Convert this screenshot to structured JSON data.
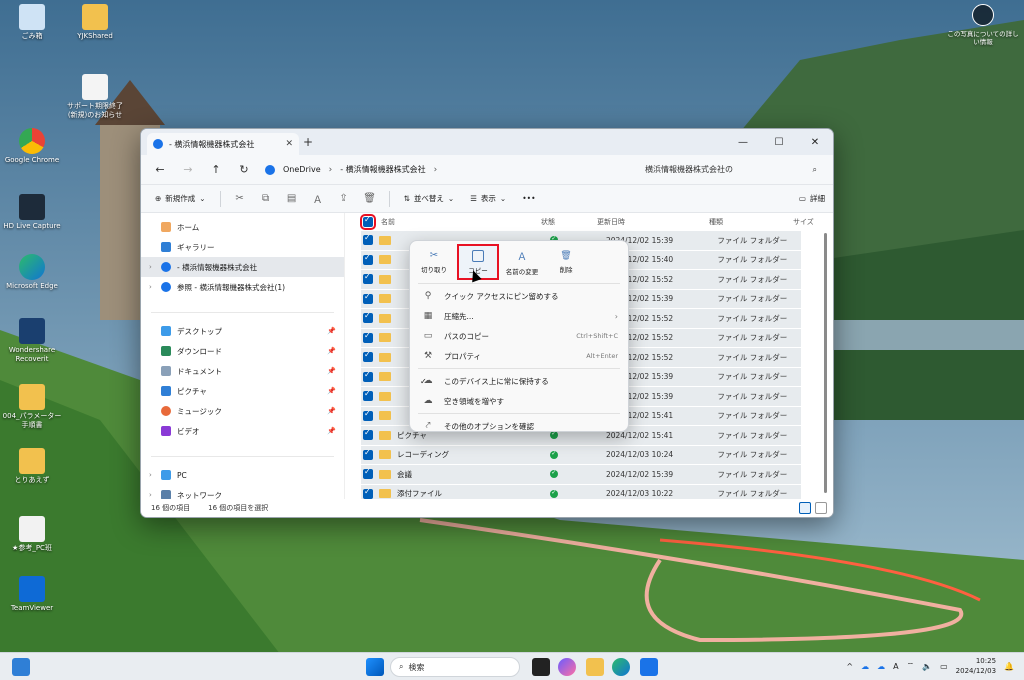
{
  "desktop": {
    "icons": [
      {
        "label": "ごみ箱"
      },
      {
        "label": "YJKShared"
      },
      {
        "label": "サポート期限終了(新規)のお知らせ"
      },
      {
        "label": "Google Chrome"
      },
      {
        "label": "HD Live Capture"
      },
      {
        "label": "Microsoft Edge"
      },
      {
        "label": "Wondershare Recoverit"
      },
      {
        "label": "004_パラメーター手順書"
      },
      {
        "label": "とりあえず"
      },
      {
        "label": "★参考_PC班"
      },
      {
        "label": "TeamViewer"
      }
    ],
    "photo_info": "この写真についての詳しい情報"
  },
  "window": {
    "tab_title": "- 横浜情報機器株式会社",
    "crumbs": [
      "OneDrive",
      "- 横浜情報機器株式会社"
    ],
    "search_placeholder": "横浜情報機器株式会社の",
    "toolbar": {
      "new": "新規作成",
      "sort": "並べ替え",
      "view": "表示",
      "more": "•••",
      "details": "詳細"
    },
    "nav": {
      "home": "ホーム",
      "gallery": "ギャラリー",
      "onedrive_org": "- 横浜情報機器株式会社",
      "onedrive_personal": "参照 - 横浜情報機器株式会社(1)",
      "desktop": "デスクトップ",
      "downloads": "ダウンロード",
      "documents": "ドキュメント",
      "pictures": "ピクチャ",
      "music": "ミュージック",
      "videos": "ビデオ",
      "pc": "PC",
      "network": "ネットワーク"
    },
    "columns": {
      "name": "名前",
      "status": "状態",
      "date": "更新日時",
      "type": "種類",
      "size": "サイズ"
    },
    "rows": [
      {
        "name": "",
        "date": "2024/12/02 15:39",
        "type": "ファイル フォルダー"
      },
      {
        "name": "",
        "date": "2024/12/02 15:40",
        "type": "ファイル フォルダー"
      },
      {
        "name": "",
        "date": "2024/12/02 15:52",
        "type": "ファイル フォルダー"
      },
      {
        "name": "",
        "date": "2024/12/02 15:39",
        "type": "ファイル フォルダー"
      },
      {
        "name": "",
        "date": "2024/12/02 15:52",
        "type": "ファイル フォルダー"
      },
      {
        "name": "",
        "date": "2024/12/02 15:52",
        "type": "ファイル フォルダー"
      },
      {
        "name": "",
        "date": "2024/12/02 15:52",
        "type": "ファイル フォルダー"
      },
      {
        "name": "",
        "date": "2024/12/02 15:39",
        "type": "ファイル フォルダー"
      },
      {
        "name": "",
        "date": "2024/12/02 15:39",
        "type": "ファイル フォルダー"
      },
      {
        "name": "",
        "date": "2024/12/02 15:41",
        "type": "ファイル フォルダー"
      },
      {
        "name": "ピクチャ",
        "date": "2024/12/02 15:41",
        "type": "ファイル フォルダー"
      },
      {
        "name": "レコーディング",
        "date": "2024/12/03 10:24",
        "type": "ファイル フォルダー"
      },
      {
        "name": "会議",
        "date": "2024/12/02 15:39",
        "type": "ファイル フォルダー"
      },
      {
        "name": "添付ファイル",
        "date": "2024/12/03 10:22",
        "type": "ファイル フォルダー"
      }
    ],
    "status_count": "16 個の項目",
    "status_selected": "16 個の項目を選択"
  },
  "context_menu": {
    "actions": [
      {
        "label": "切り取り"
      },
      {
        "label": "コピー"
      },
      {
        "label": "名前の変更"
      },
      {
        "label": "削除"
      }
    ],
    "items": {
      "pin_quick": "クイック アクセスにピン留めする",
      "compress": "圧縮先...",
      "copy_path": "パスのコピー",
      "copy_path_shortcut": "Ctrl+Shift+C",
      "properties": "プロパティ",
      "properties_shortcut": "Alt+Enter",
      "keep_on_device": "このデバイス上に常に保持する",
      "free_space": "空き領域を増やす",
      "more_options": "その他のオプションを確認"
    }
  },
  "taskbar": {
    "search_placeholder": "検索",
    "time": "10:25",
    "date": "2024/12/03"
  },
  "colors": {
    "accent": "#005fb8",
    "highlight": "#e81123",
    "folder": "#f2c14e",
    "sync_ok": "#1ca14a"
  }
}
